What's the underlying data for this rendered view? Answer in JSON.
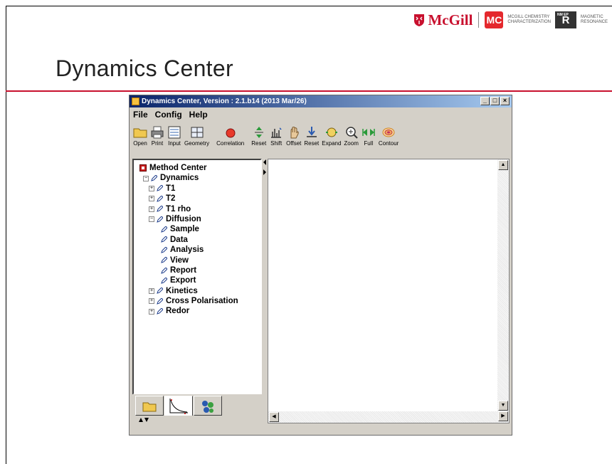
{
  "slide": {
    "title": "Dynamics Center",
    "logos": {
      "mcgill": "McGill",
      "mc_badge": "MC",
      "mc_text_1": "McGill Chemistry",
      "mc_text_2": "Characterization",
      "nmr_small": "NM EP",
      "nmr_letter": "R",
      "mr_text_1": "Magnetic",
      "mr_text_2": "Resonance"
    },
    "accent_color": "#c8102e"
  },
  "app": {
    "window_title": "Dynamics Center, Version : 2.1.b14 (2013 Mar/26)",
    "window_buttons": [
      "_",
      "□",
      "×"
    ],
    "menu": [
      "File",
      "Config",
      "Help"
    ],
    "toolbar": [
      {
        "label": "Open",
        "icon": "folder-icon"
      },
      {
        "label": "Print",
        "icon": "printer-icon"
      },
      {
        "label": "Input",
        "icon": "input-icon"
      },
      {
        "label": "Geometry",
        "icon": "geometry-icon"
      },
      {
        "label": "Correlation",
        "icon": "correlation-icon"
      },
      {
        "label": "Reset",
        "icon": "reset-icon"
      },
      {
        "label": "Shift",
        "icon": "shift-icon"
      },
      {
        "label": "Offset",
        "icon": "offset-icon"
      },
      {
        "label": "Reset",
        "icon": "reset-down-icon"
      },
      {
        "label": "Expand",
        "icon": "expand-icon"
      },
      {
        "label": "Zoom",
        "icon": "zoom-icon"
      },
      {
        "label": "Full",
        "icon": "full-icon"
      },
      {
        "label": "Contour",
        "icon": "contour-icon"
      }
    ],
    "tree": {
      "root": "Method Center",
      "dynamics": "Dynamics",
      "items": [
        {
          "label": "T1",
          "level": 2,
          "expander": "+"
        },
        {
          "label": "T2",
          "level": 2,
          "expander": "+"
        },
        {
          "label": "T1 rho",
          "level": 2,
          "expander": "+"
        },
        {
          "label": "Diffusion",
          "level": 2,
          "expander": "−"
        },
        {
          "label": "Sample",
          "level": 3,
          "expander": ""
        },
        {
          "label": "Data",
          "level": 3,
          "expander": ""
        },
        {
          "label": "Analysis",
          "level": 3,
          "expander": ""
        },
        {
          "label": "View",
          "level": 3,
          "expander": ""
        },
        {
          "label": "Report",
          "level": 3,
          "expander": ""
        },
        {
          "label": "Export",
          "level": 3,
          "expander": ""
        },
        {
          "label": "Kinetics",
          "level": 2,
          "expander": "+"
        },
        {
          "label": "Cross Polarisation",
          "level": 2,
          "expander": "+"
        },
        {
          "label": "Redor",
          "level": 2,
          "expander": "+"
        }
      ]
    }
  }
}
